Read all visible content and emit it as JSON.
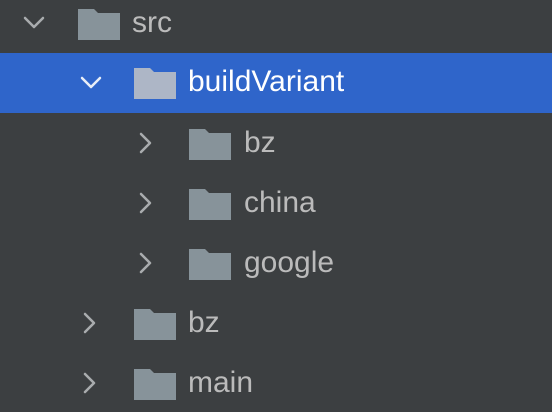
{
  "tree": {
    "selected_color": "#2f65ca",
    "items": [
      {
        "label": "src",
        "expanded": true,
        "selected": false,
        "icon": "folder-icon"
      },
      {
        "label": "buildVariant",
        "expanded": true,
        "selected": true,
        "icon": "folder-icon"
      },
      {
        "label": "bz",
        "expanded": false,
        "selected": false,
        "icon": "folder-icon"
      },
      {
        "label": "china",
        "expanded": false,
        "selected": false,
        "icon": "folder-icon"
      },
      {
        "label": "google",
        "expanded": false,
        "selected": false,
        "icon": "folder-icon"
      },
      {
        "label": "bz",
        "expanded": false,
        "selected": false,
        "icon": "folder-icon"
      },
      {
        "label": "main",
        "expanded": false,
        "selected": false,
        "icon": "folder-icon"
      }
    ]
  }
}
